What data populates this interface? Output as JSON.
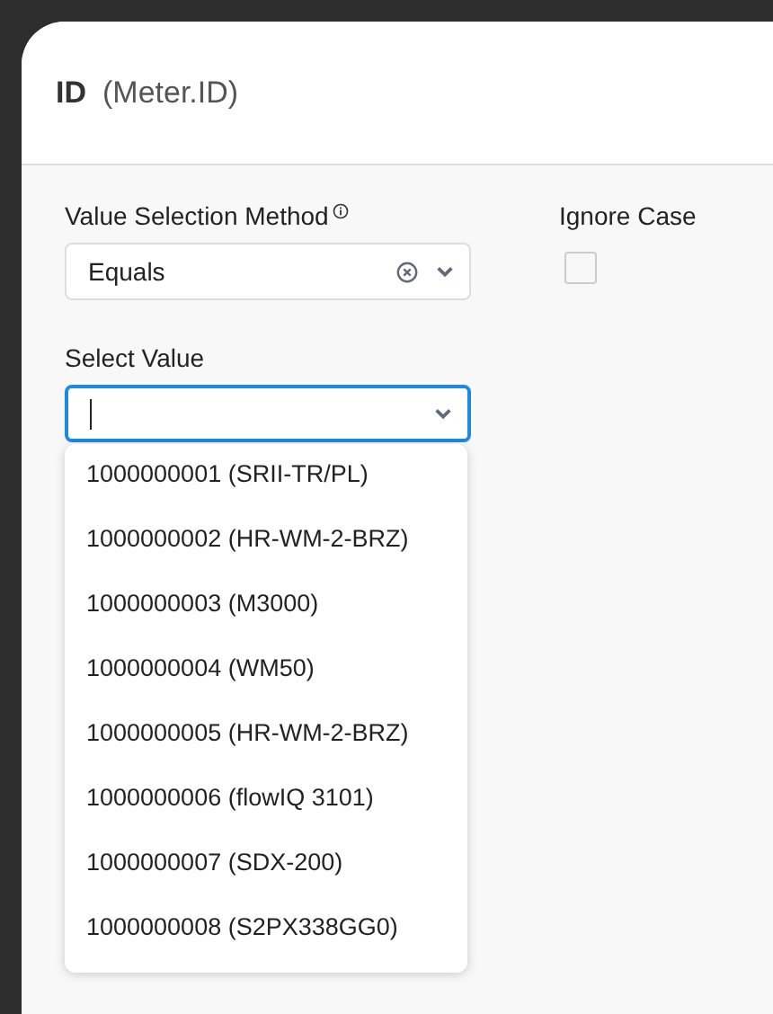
{
  "dialog": {
    "title": "ID",
    "subtitle": "(Meter.ID)"
  },
  "method_field": {
    "label": "Value Selection Method",
    "value": "Equals"
  },
  "ignore_case": {
    "label": "Ignore Case",
    "checked": false
  },
  "value_field": {
    "label": "Select Value",
    "focused": true
  },
  "options": [
    {
      "label": "1000000001 (SRII-TR/PL)"
    },
    {
      "label": "1000000002 (HR-WM-2-BRZ)"
    },
    {
      "label": "1000000003 (M3000)"
    },
    {
      "label": "1000000004 (WM50)"
    },
    {
      "label": "1000000005 (HR-WM-2-BRZ)"
    },
    {
      "label": "1000000006 (flowIQ 3101)"
    },
    {
      "label": "1000000007 (SDX-200)"
    },
    {
      "label": "1000000008 (S2PX338GG0)"
    }
  ]
}
